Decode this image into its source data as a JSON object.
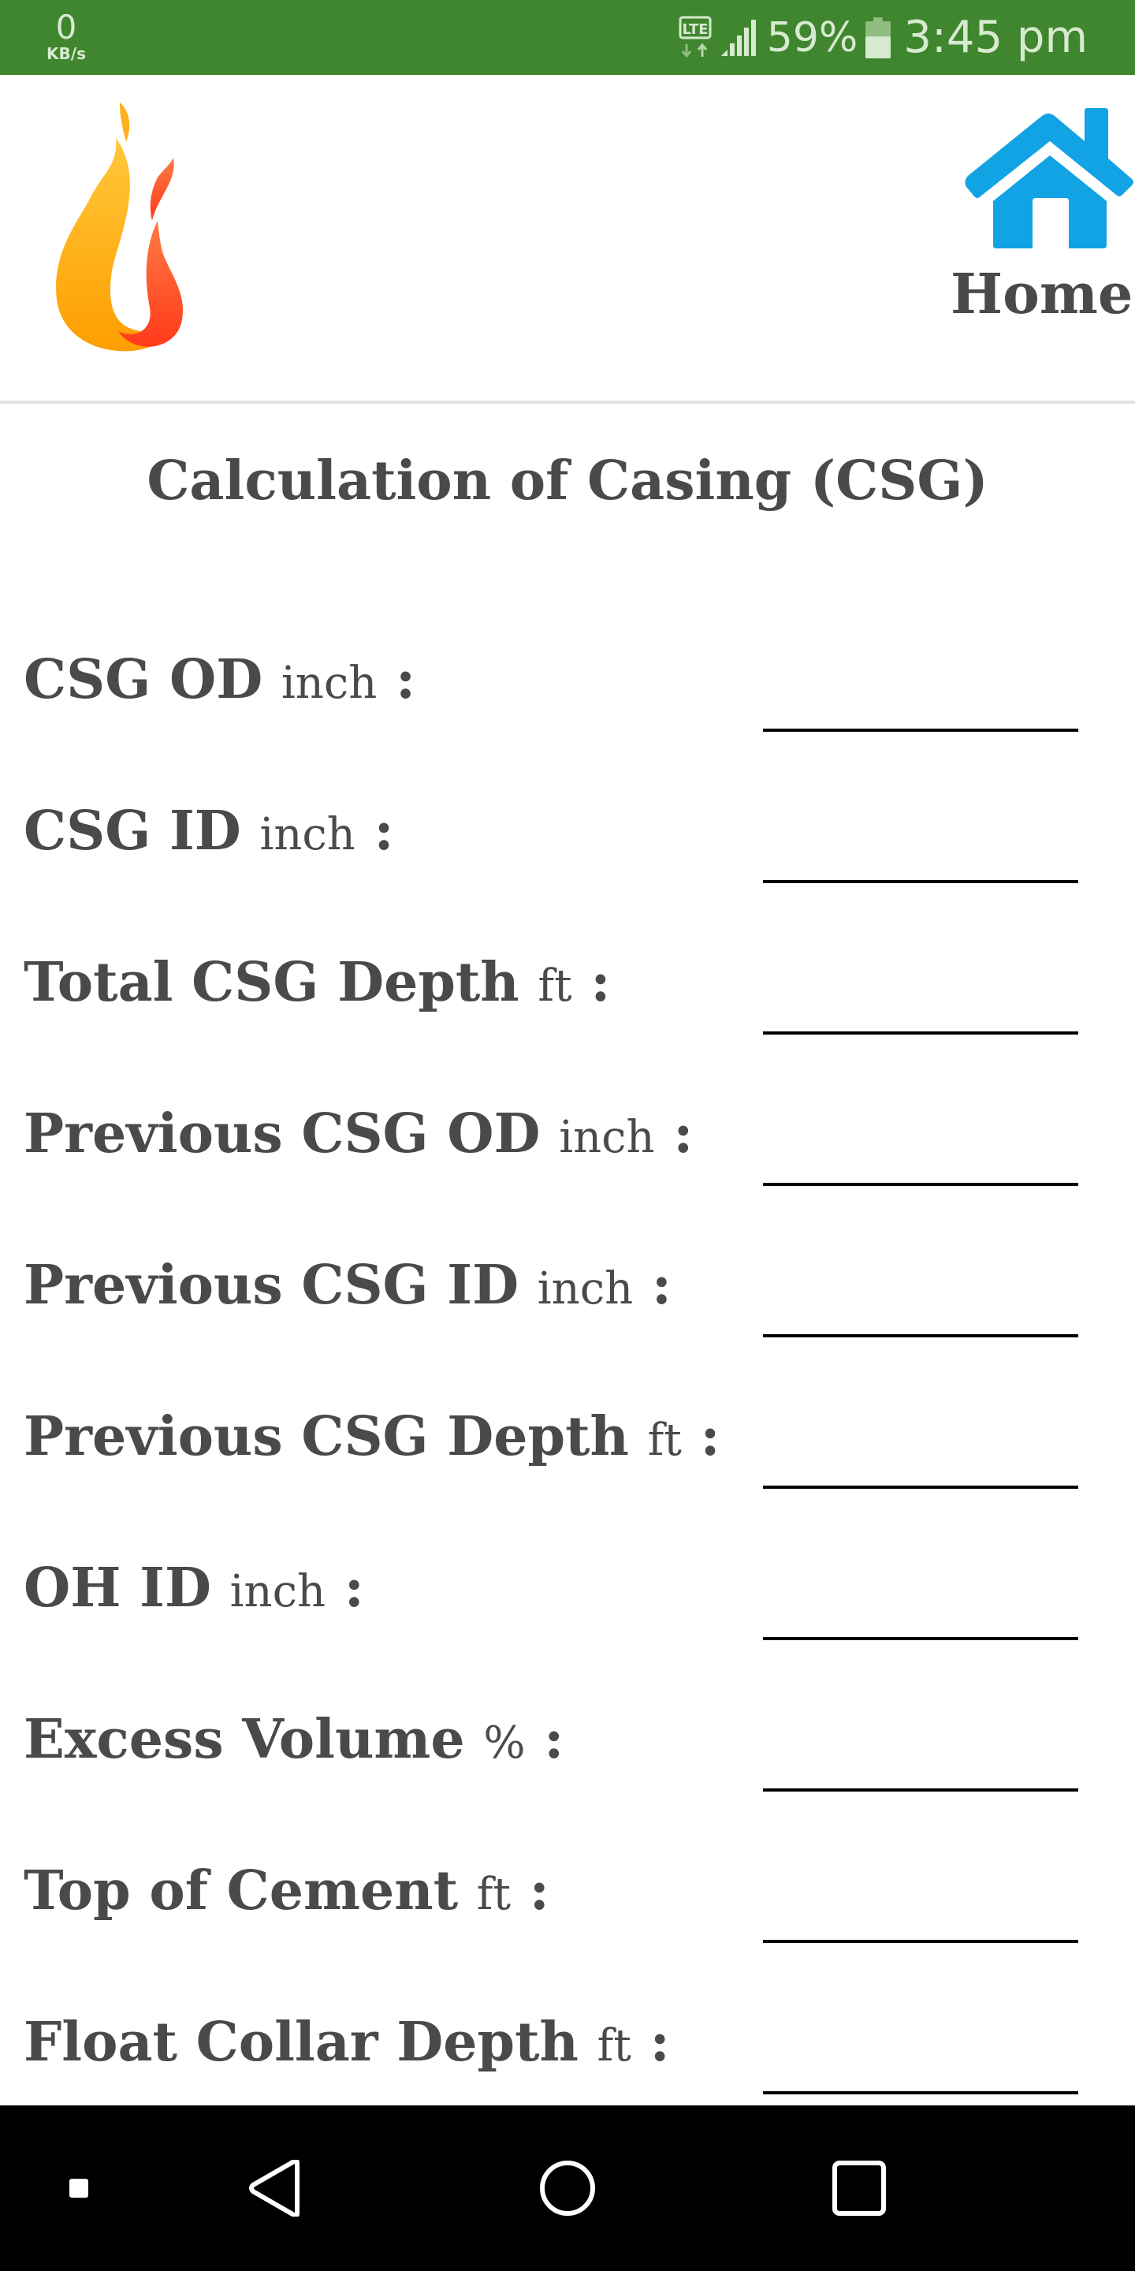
{
  "status_bar": {
    "net_speed_value": "0",
    "net_speed_unit": "KB/s",
    "network_type": "LTE",
    "battery_percent": "59%",
    "battery_level": 0.59,
    "time": "3:45 pm",
    "bg_color": "#3F862E"
  },
  "header": {
    "logo_icon": "flame-logo",
    "home_icon": "house-icon",
    "home_label": "Home",
    "home_icon_color": "#11A3E3"
  },
  "page": {
    "title": "Calculation of Casing (CSG)"
  },
  "form": {
    "fields": [
      {
        "label": "CSG OD",
        "unit": "inch",
        "colon": ":",
        "value": ""
      },
      {
        "label": "CSG ID",
        "unit": "inch",
        "colon": ":",
        "value": ""
      },
      {
        "label": "Total CSG Depth",
        "unit": "ft",
        "colon": ":",
        "value": ""
      },
      {
        "label": "Previous CSG OD",
        "unit": "inch",
        "colon": ":",
        "value": ""
      },
      {
        "label": "Previous CSG ID",
        "unit": "inch",
        "colon": ":",
        "value": ""
      },
      {
        "label": "Previous CSG Depth",
        "unit": "ft",
        "colon": ":",
        "value": ""
      },
      {
        "label": "OH ID",
        "unit": "inch",
        "colon": ":",
        "value": ""
      },
      {
        "label": "Excess Volume",
        "unit": "%",
        "colon": ":",
        "value": ""
      },
      {
        "label": "Top of Cement",
        "unit": "ft",
        "colon": ":",
        "value": ""
      },
      {
        "label": "Float Collar Depth",
        "unit": "ft",
        "colon": ":",
        "value": ""
      }
    ]
  },
  "nav_bar": {
    "buttons": [
      "menu-dot",
      "back",
      "home",
      "recents"
    ]
  }
}
